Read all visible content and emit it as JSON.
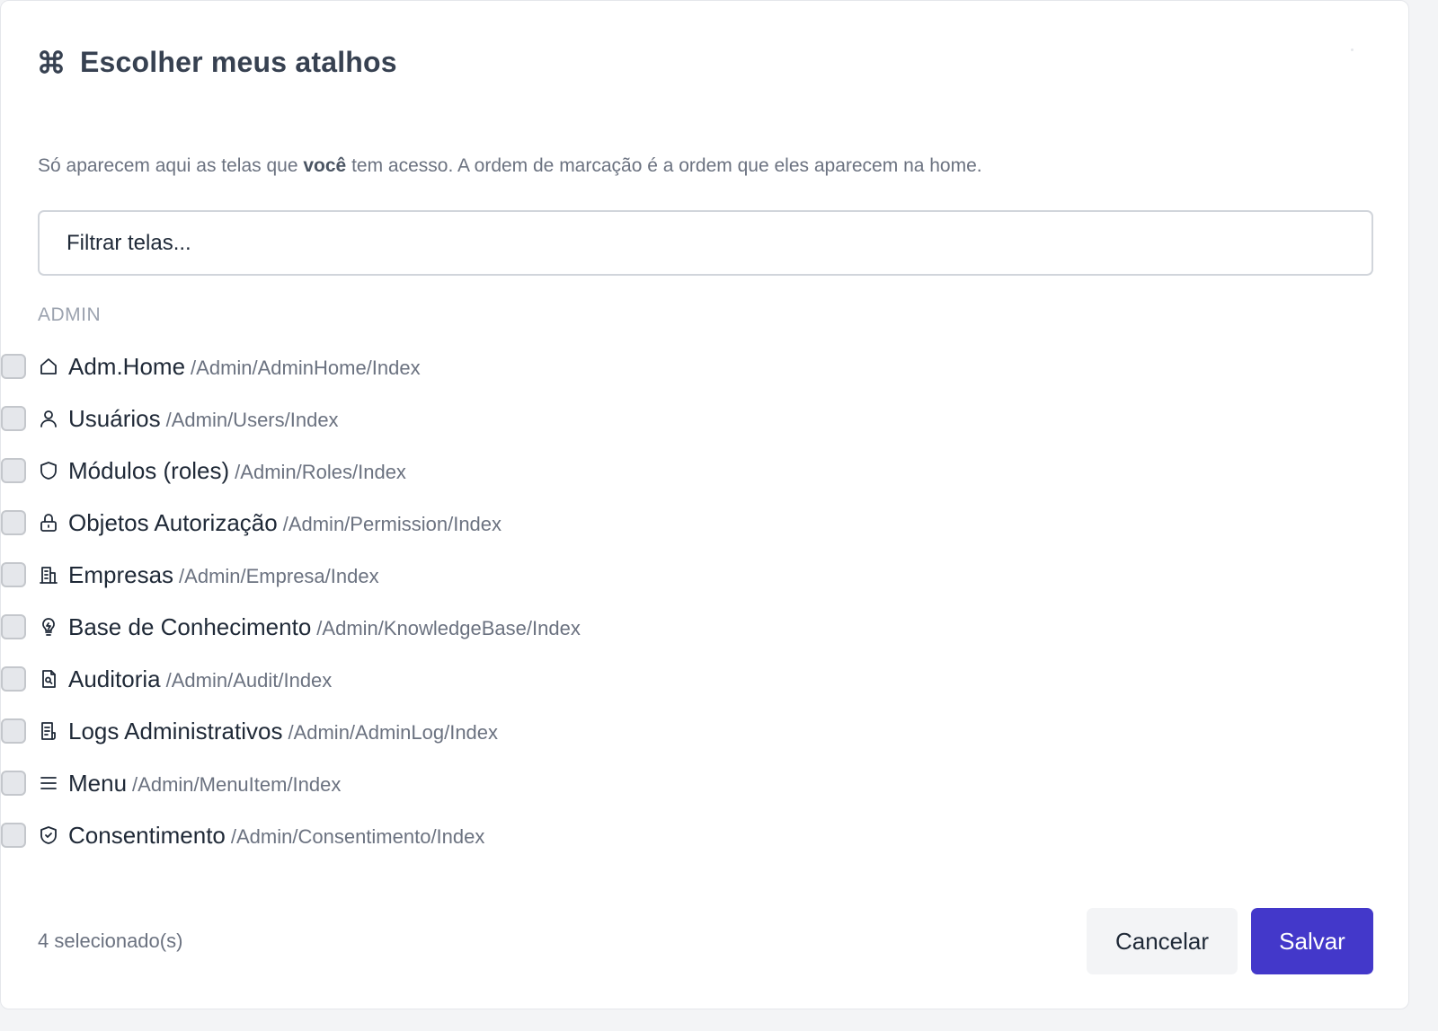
{
  "modal": {
    "title": "Escolher meus atalhos",
    "title_icon": "command-icon",
    "description_before": "Só aparecem aqui as telas que ",
    "description_bold": "você",
    "description_after": " tem acesso. A ordem de marcação é a ordem que eles aparecem na home.",
    "filter_placeholder": "Filtrar telas...",
    "group_label": "ADMIN",
    "items": [
      {
        "label": "Adm.Home",
        "path": "/Admin/AdminHome/Index",
        "icon": "home-icon",
        "checked": false
      },
      {
        "label": "Usuários",
        "path": "/Admin/Users/Index",
        "icon": "user-icon",
        "checked": false
      },
      {
        "label": "Módulos (roles)",
        "path": "/Admin/Roles/Index",
        "icon": "shield-icon",
        "checked": false
      },
      {
        "label": "Objetos Autorização",
        "path": "/Admin/Permission/Index",
        "icon": "lock-icon",
        "checked": false
      },
      {
        "label": "Empresas",
        "path": "/Admin/Empresa/Index",
        "icon": "building-icon",
        "checked": false
      },
      {
        "label": "Base de Conhecimento",
        "path": "/Admin/KnowledgeBase/Index",
        "icon": "lightbulb-icon",
        "checked": false
      },
      {
        "label": "Auditoria",
        "path": "/Admin/Audit/Index",
        "icon": "file-search-icon",
        "checked": false
      },
      {
        "label": "Logs Administrativos",
        "path": "/Admin/AdminLog/Index",
        "icon": "log-file-icon",
        "checked": false
      },
      {
        "label": "Menu",
        "path": "/Admin/MenuItem/Index",
        "icon": "menu-icon",
        "checked": false
      },
      {
        "label": "Consentimento",
        "path": "/Admin/Consentimento/Index",
        "icon": "shield-check-icon",
        "checked": false
      }
    ],
    "selected_count_text": "4 selecionado(s)",
    "cancel_label": "Cancelar",
    "save_label": "Salvar"
  },
  "colors": {
    "primary": "#4338ca",
    "text": "#1f2937",
    "muted": "#6b7280"
  }
}
